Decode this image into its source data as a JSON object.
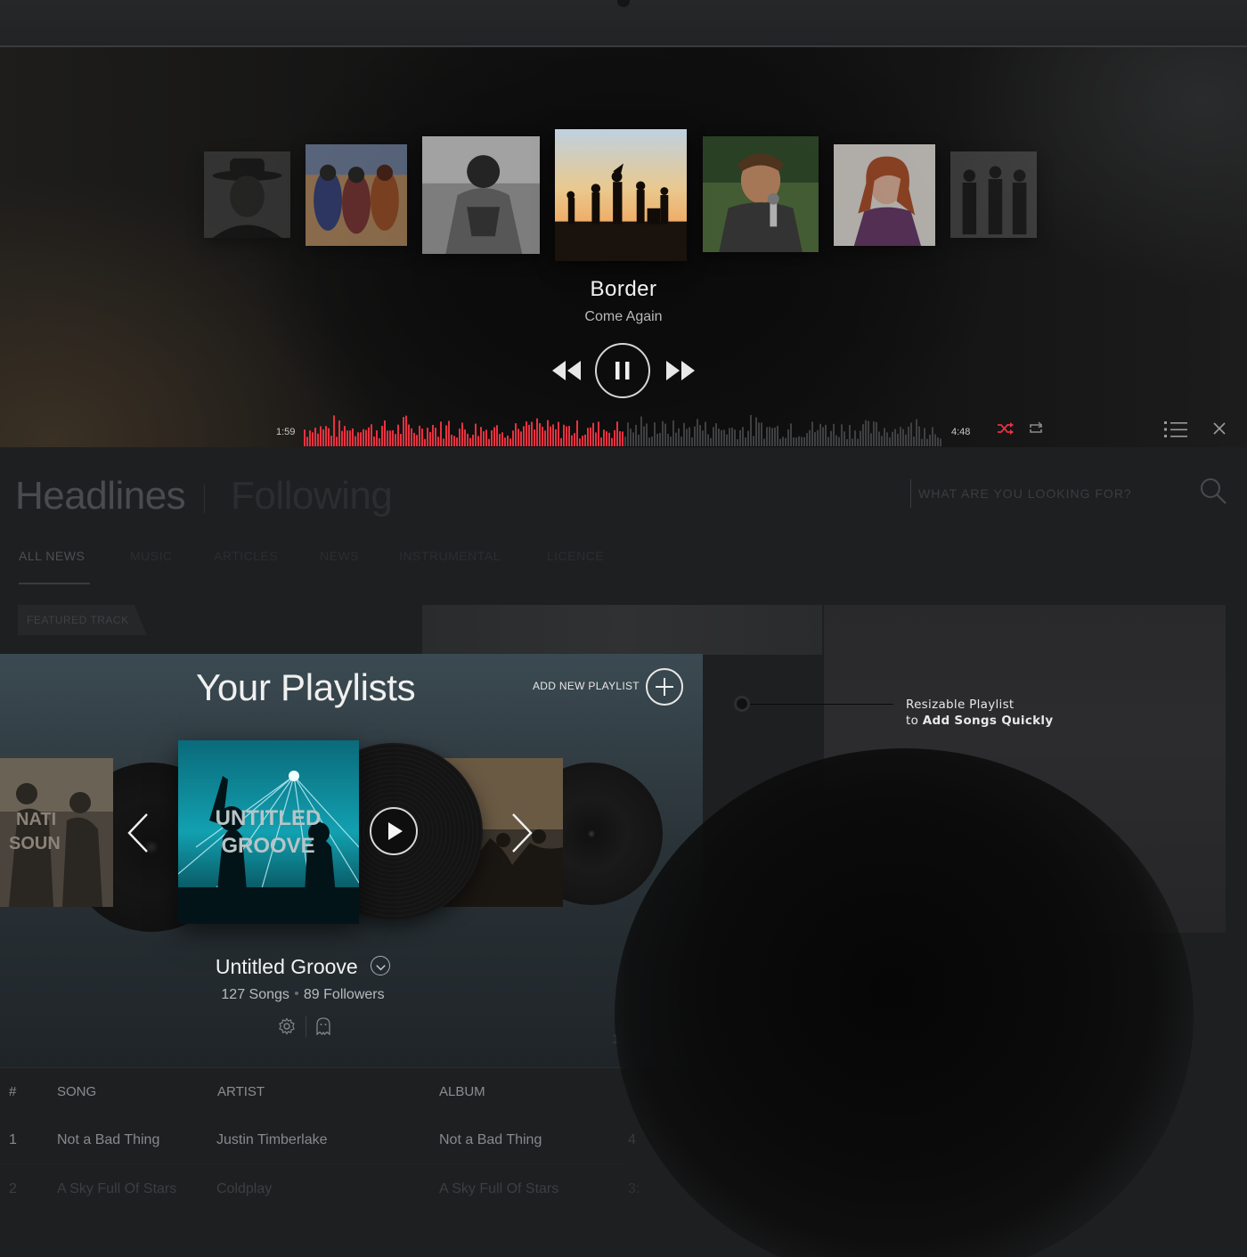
{
  "now_playing": {
    "title": "Border",
    "artist": "Come Again",
    "elapsed": "1:59",
    "duration": "4:48",
    "progress": 0.5,
    "accent_color": "#e8313f"
  },
  "player_controls": {
    "previous_icon": "rewind-icon",
    "pause_icon": "pause-icon",
    "next_icon": "fast-forward-icon",
    "shuffle_icon": "shuffle-icon",
    "repeat_icon": "repeat-icon",
    "queue_icon": "list-icon",
    "close_icon": "close-icon"
  },
  "news": {
    "tabs": [
      "Headlines",
      "Following"
    ],
    "search_placeholder": "WHAT ARE YOU LOOKING FOR?",
    "subtabs": [
      "ALL NEWS",
      "MUSIC",
      "ARTICLES",
      "NEWS",
      "INSTRUMENTAL",
      "LICENCE"
    ],
    "featured_label": "FEATURED TRACK"
  },
  "playlists": {
    "title": "Your Playlists",
    "add_label": "ADD NEW PLAYLIST",
    "current": {
      "cover_text_line1": "UNTITLED",
      "cover_text_line2": "GROOVE",
      "name": "Untitled Groove",
      "songs": "127 Songs",
      "followers": "89 Followers"
    },
    "left_cover_text_line1": "NATI",
    "left_cover_text_line2": "SOUN"
  },
  "annotation": {
    "line1": "Resizable Playlist",
    "line2_prefix": "to ",
    "line2_bold": "Add Songs Quickly"
  },
  "table": {
    "headers": [
      "#",
      "SONG",
      "ARTIST",
      "ALBUM"
    ],
    "rows": [
      {
        "num": "1",
        "song": "Not a Bad Thing",
        "artist": "Justin Timberlake",
        "album": "Not a Bad Thing",
        "extra": "4"
      },
      {
        "num": "2",
        "song": "A Sky Full Of Stars",
        "artist": "Coldplay",
        "album": "A Sky Full Of Stars",
        "extra": "3:"
      }
    ],
    "faded_count": "1"
  }
}
